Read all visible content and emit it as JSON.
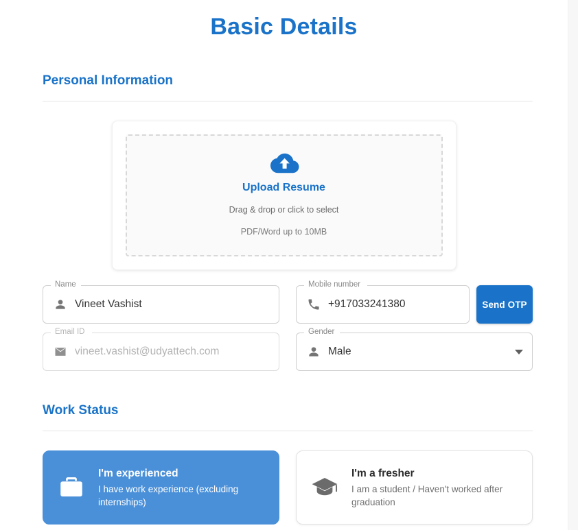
{
  "page": {
    "title": "Basic Details"
  },
  "personal_section": {
    "heading": "Personal Information",
    "upload": {
      "icon": "cloud-upload-icon",
      "title": "Upload Resume",
      "hint": "Drag & drop or click to select",
      "constraint": "PDF/Word up to 10MB"
    },
    "fields": {
      "name": {
        "label": "Name",
        "value": "Vineet Vashist",
        "icon": "person-icon"
      },
      "mobile": {
        "label": "Mobile number",
        "value": "+917033241380",
        "icon": "phone-icon",
        "button_label": "Send OTP"
      },
      "email": {
        "label": "Email ID",
        "value": "vineet.vashist@udyattech.com",
        "icon": "envelope-icon"
      },
      "gender": {
        "label": "Gender",
        "value": "Male",
        "icon": "person-icon",
        "caret": "chevron-down-icon"
      }
    }
  },
  "work_status_section": {
    "heading": "Work Status",
    "options": [
      {
        "title": "I'm experienced",
        "description": "I have work experience (excluding internships)",
        "icon": "briefcase-icon",
        "selected": true
      },
      {
        "title": "I'm a fresher",
        "description": "I am a student / Haven't worked after graduation",
        "icon": "graduation-cap-icon",
        "selected": false
      }
    ]
  },
  "colors": {
    "primary_blue": "#1a73c8",
    "selected_card_blue": "#4a90d9",
    "label_gray": "#8a8a8a",
    "value_gray": "#333333",
    "placeholder_gray": "#b3b3b3",
    "divider_gray": "#e6e6e6"
  }
}
